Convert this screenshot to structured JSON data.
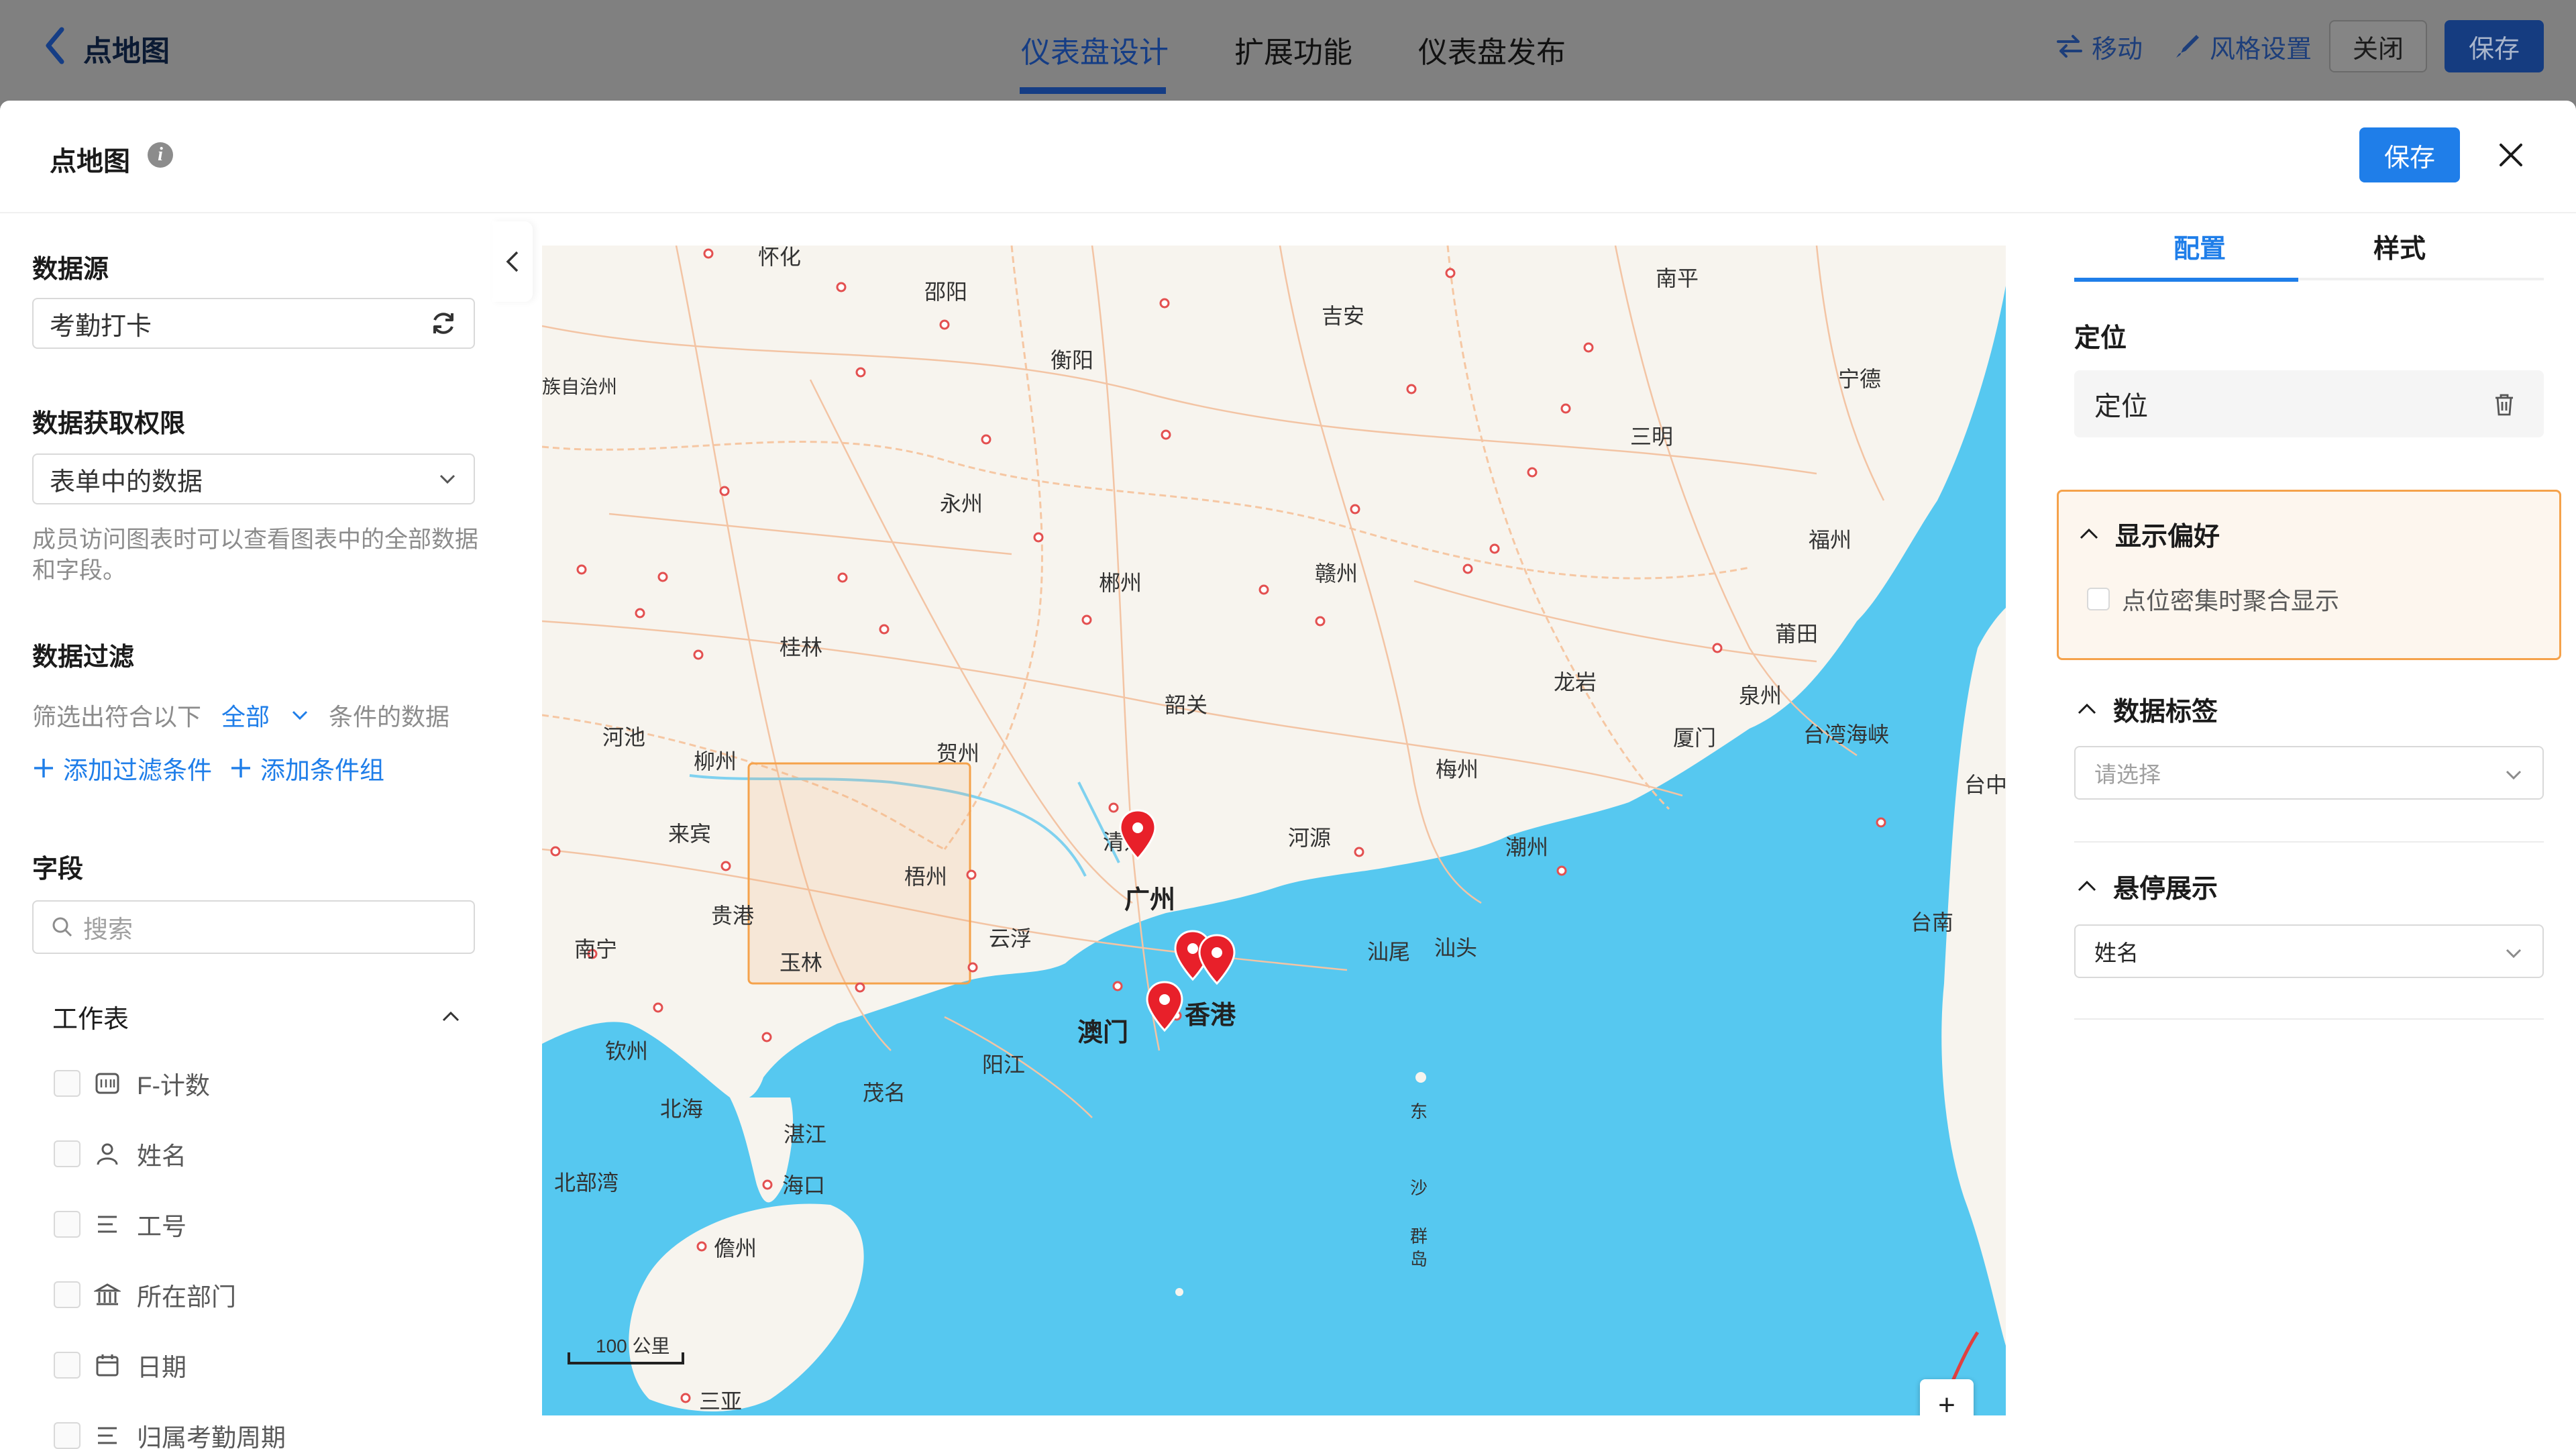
{
  "background": {
    "title": "点地图",
    "tabs": [
      {
        "label": "仪表盘设计",
        "active": true
      },
      {
        "label": "扩展功能",
        "active": false
      },
      {
        "label": "仪表盘发布",
        "active": false
      }
    ],
    "actions": {
      "move": "移动",
      "style": "风格设置",
      "close": "关闭",
      "save": "保存"
    }
  },
  "dialog": {
    "title": "点地图",
    "save": "保存",
    "close_icon": "close-icon"
  },
  "left": {
    "datasource_title": "数据源",
    "datasource_value": "考勤打卡",
    "permission_title": "数据获取权限",
    "permission_value": "表单中的数据",
    "permission_hint": "成员访问图表时可以查看图表中的全部数据和字段。",
    "filter_title": "数据过滤",
    "filter_prefix": "筛选出符合以下",
    "filter_mode": "全部",
    "filter_suffix": "条件的数据",
    "add_filter": "添加过滤条件",
    "add_group": "添加条件组",
    "fields_title": "字段",
    "search_placeholder": "搜索",
    "worksheet_label": "工作表",
    "fields": [
      {
        "label": "F-计数",
        "icon": "counter-icon"
      },
      {
        "label": "姓名",
        "icon": "person-icon"
      },
      {
        "label": "工号",
        "icon": "text-lines-icon"
      },
      {
        "label": "所在部门",
        "icon": "department-icon"
      },
      {
        "label": "日期",
        "icon": "calendar-icon"
      },
      {
        "label": "归属考勤周期",
        "icon": "text-lines-icon"
      }
    ]
  },
  "map": {
    "scale_label": "100 公里",
    "zoom_in": "+",
    "zoom_out": "-",
    "cities": [
      "怀化",
      "邵阳",
      "衡阳",
      "吉安",
      "南平",
      "宁德",
      "永州",
      "三明",
      "福州",
      "郴州",
      "赣州",
      "桂林",
      "莆田",
      "龙岩",
      "韶关",
      "泉州",
      "河池",
      "柳州",
      "贺州",
      "梅州",
      "厦门",
      "台湾海峡",
      "台中",
      "来宾",
      "梧州",
      "清远",
      "河源",
      "潮州",
      "贵港",
      "广州",
      "南宁",
      "玉林",
      "云浮",
      "汕尾",
      "汕头",
      "台南",
      "香港",
      "澳门",
      "钦州",
      "茂名",
      "阳江",
      "北海",
      "湛江",
      "北部湾",
      "海口",
      "儋州",
      "三亚",
      "东",
      "沙",
      "群",
      "岛"
    ],
    "city_extra": "族自治州"
  },
  "right": {
    "tab_config": "配置",
    "tab_style": "样式",
    "position_title": "定位",
    "position_value": "定位",
    "display_pref_title": "显示偏好",
    "cluster_label": "点位密集时聚合显示",
    "data_label_title": "数据标签",
    "data_label_placeholder": "请选择",
    "hover_title": "悬停展示",
    "hover_value": "姓名"
  },
  "colors": {
    "primary": "#1f7ee9",
    "highlight_border": "#f5a24b",
    "sea": "#56c8f0",
    "marker": "#e8202a"
  }
}
